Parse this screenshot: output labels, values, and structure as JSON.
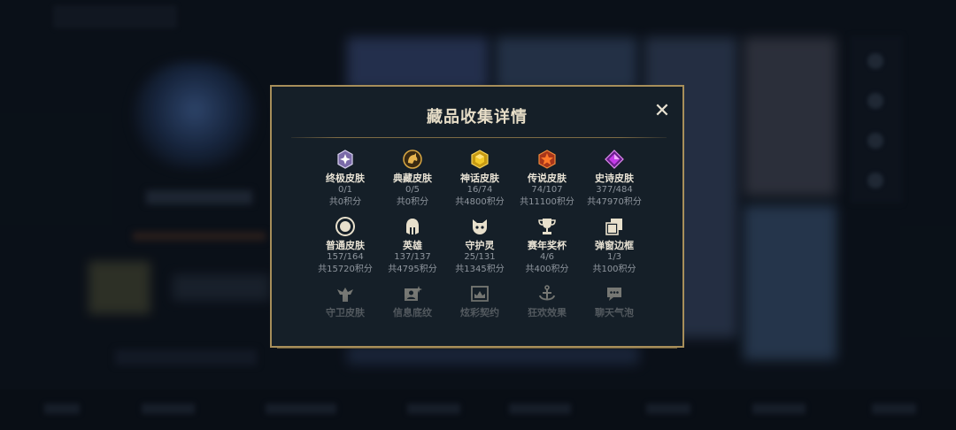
{
  "modal": {
    "title": "藏品收集详情",
    "close_label": "✕"
  },
  "categories": [
    {
      "name": "终极皮肤",
      "count": "0/1",
      "points": "共0积分",
      "icon": "ultimate-skin-icon"
    },
    {
      "name": "典藏皮肤",
      "count": "0/5",
      "points": "共0积分",
      "icon": "prestige-skin-icon"
    },
    {
      "name": "神话皮肤",
      "count": "16/74",
      "points": "共4800积分",
      "icon": "mythic-skin-icon"
    },
    {
      "name": "传说皮肤",
      "count": "74/107",
      "points": "共11100积分",
      "icon": "legendary-skin-icon"
    },
    {
      "name": "史诗皮肤",
      "count": "377/484",
      "points": "共47970积分",
      "icon": "epic-skin-icon"
    },
    {
      "name": "普通皮肤",
      "count": "157/164",
      "points": "共15720积分",
      "icon": "standard-skin-icon"
    },
    {
      "name": "英雄",
      "count": "137/137",
      "points": "共4795积分",
      "icon": "champion-helmet-icon"
    },
    {
      "name": "守护灵",
      "count": "25/131",
      "points": "共1345积分",
      "icon": "companion-icon"
    },
    {
      "name": "赛年奖杯",
      "count": "4/6",
      "points": "共400积分",
      "icon": "trophy-icon"
    },
    {
      "name": "弹窗边框",
      "count": "1/3",
      "points": "共100积分",
      "icon": "frame-icon"
    },
    {
      "name": "守卫皮肤",
      "icon": "ward-skin-icon"
    },
    {
      "name": "信息底纹",
      "icon": "banner-icon"
    },
    {
      "name": "炫彩契约",
      "icon": "chroma-icon"
    },
    {
      "name": "狂欢效果",
      "icon": "emote-effect-icon"
    },
    {
      "name": "聊天气泡",
      "icon": "chat-bubble-icon"
    }
  ],
  "colors": {
    "modal_border": "#a78e5a",
    "modal_bg": "#151f28",
    "title": "#e6ddc7",
    "secondary_text": "#8f969e"
  }
}
